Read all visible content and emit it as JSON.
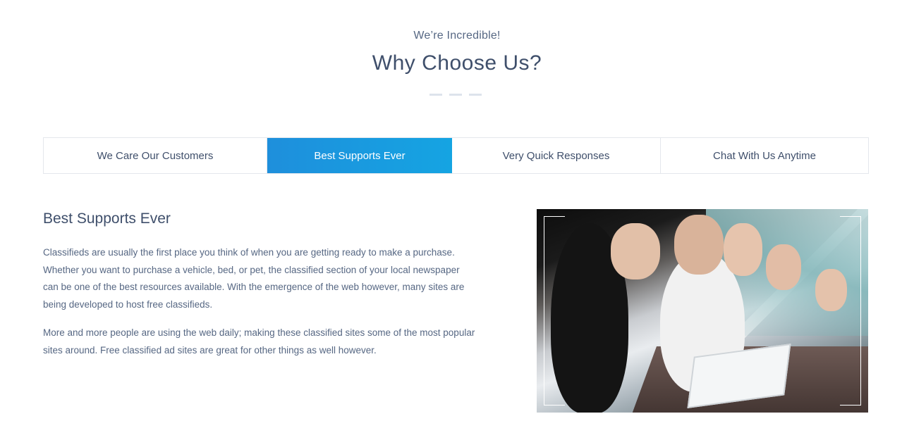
{
  "section": {
    "eyebrow": "We’re Incredible!",
    "title": "Why Choose Us?"
  },
  "tabs": [
    {
      "label": "We Care Our Customers",
      "active": false
    },
    {
      "label": "Best Supports Ever",
      "active": true
    },
    {
      "label": "Very Quick Responses",
      "active": false
    },
    {
      "label": "Chat With Us Anytime",
      "active": false
    }
  ],
  "content": {
    "title": "Best Supports Ever",
    "paragraphs": [
      "Classifieds are usually the first place you think of when you are getting ready to make a purchase. Whether you want to purchase a vehicle, bed, or pet, the classified section of your local newspaper can be one of the best resources available. With the emergence of the web however, many sites are being developed to host free classifieds.",
      "More and more people are using the web daily; making these classified sites some of the most popular sites around. Free classified ad sites are great for other things as well however."
    ]
  },
  "colors": {
    "heading": "#3f4f6b",
    "body_text": "#566783",
    "active_tab_start": "#1e8fdc",
    "active_tab_end": "#15a4e2",
    "border": "#e4e7ec"
  }
}
